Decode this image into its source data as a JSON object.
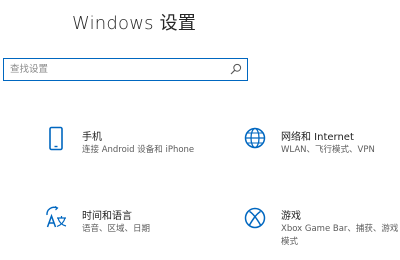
{
  "window": {
    "title": "Windows 设置"
  },
  "search": {
    "placeholder": "查找设置",
    "value": ""
  },
  "icons": {
    "search": "search-icon",
    "phone": "phone-icon",
    "network": "globe-icon",
    "time_language": "time-language-icon",
    "gaming": "xbox-icon"
  },
  "colors": {
    "accent": "#0067c0",
    "text": "#1f1f1f",
    "secondary_text": "#5c5c5c"
  },
  "tiles": [
    {
      "title": "手机",
      "description": "连接 Android 设备和 iPhone"
    },
    {
      "title": "网络和 Internet",
      "description": "WLAN、飞行模式、VPN"
    },
    {
      "title": "时间和语言",
      "description": "语音、区域、日期"
    },
    {
      "title": "游戏",
      "description": "Xbox Game Bar、捕获、游戏模式"
    }
  ]
}
